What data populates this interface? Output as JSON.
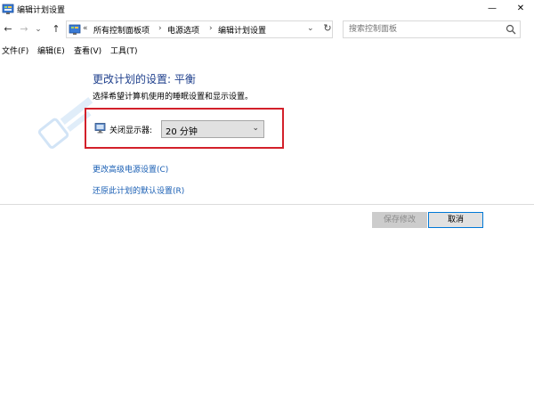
{
  "window": {
    "title": "编辑计划设置",
    "minimize": "—",
    "close": "✕"
  },
  "nav": {
    "back": "←",
    "forward": "→",
    "recent": "⌄",
    "up": "↑"
  },
  "address": {
    "overflow": "«",
    "crumbs": [
      "所有控制面板项",
      "电源选项",
      "编辑计划设置"
    ],
    "separator": "›",
    "dropdown": "⌄",
    "refresh": "↻"
  },
  "search": {
    "placeholder": "搜索控制面板"
  },
  "menu": [
    "文件(F)",
    "编辑(E)",
    "查看(V)",
    "工具(T)"
  ],
  "content": {
    "heading": "更改计划的设置: 平衡",
    "subtext": "选择希望计算机使用的睡眠设置和显示设置。",
    "display_off_label": "关闭显示器:",
    "display_off_value": "20 分钟",
    "select_arrow": "⌄",
    "links": [
      "更改高级电源设置(C)",
      "还原此计划的默认设置(R)"
    ]
  },
  "buttons": {
    "save": "保存修改",
    "cancel": "取消"
  },
  "colors": {
    "heading": "#1e3f8c",
    "link": "#1a5fb4",
    "highlight_border": "#d3202a"
  },
  "icons": {
    "app": "control-panel-icon",
    "display": "monitor-icon",
    "search": "search-icon"
  }
}
